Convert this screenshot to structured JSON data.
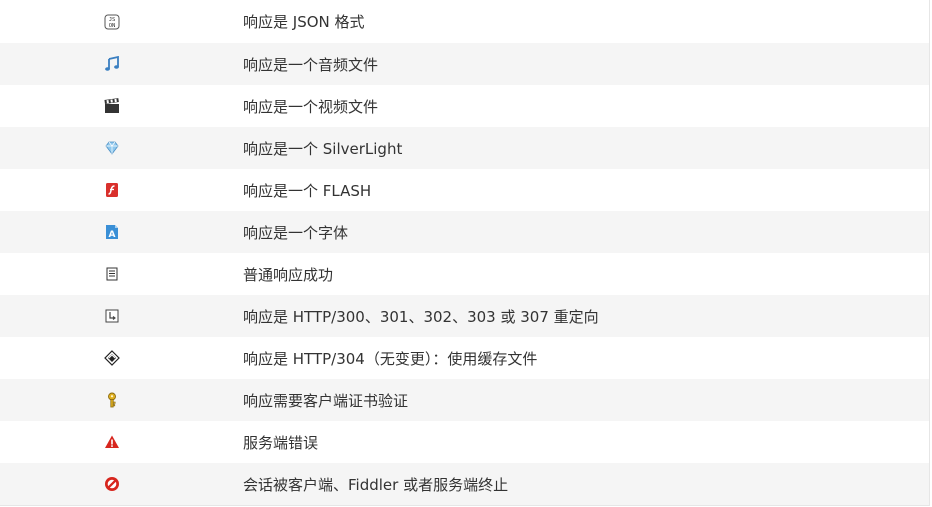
{
  "rows": [
    {
      "icon": "json-icon",
      "text": "响应是 JSON 格式"
    },
    {
      "icon": "audio-icon",
      "text": "响应是一个音频文件"
    },
    {
      "icon": "video-icon",
      "text": "响应是一个视频文件"
    },
    {
      "icon": "silverlight-icon",
      "text": "响应是一个 SilverLight"
    },
    {
      "icon": "flash-icon",
      "text": "响应是一个 FLASH"
    },
    {
      "icon": "font-icon",
      "text": "响应是一个字体"
    },
    {
      "icon": "document-icon",
      "text": "普通响应成功"
    },
    {
      "icon": "redirect-icon",
      "text": "响应是 HTTP/300、301、302、303 或 307 重定向"
    },
    {
      "icon": "cache-icon",
      "text": "响应是 HTTP/304（无变更）：使用缓存文件"
    },
    {
      "icon": "key-icon",
      "text": "响应需要客户端证书验证"
    },
    {
      "icon": "warning-icon",
      "text": "服务端错误"
    },
    {
      "icon": "blocked-icon",
      "text": "会话被客户端、Fiddler 或者服务端终止"
    }
  ]
}
